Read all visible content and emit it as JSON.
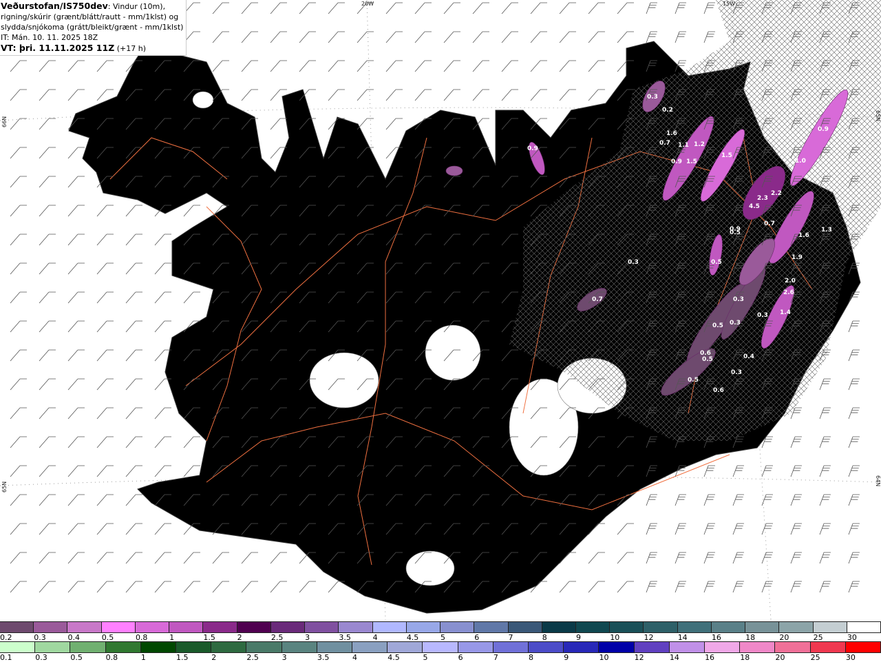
{
  "header": {
    "source": "Veðurstofan/IS750dev",
    "line1": ": Vindur (10m),",
    "line2": "rigning/skúrir (grænt/blátt/rautt - mm/1klst) og",
    "line3": "slydda/snjókoma (grátt/bleikt/grænt - mm/1klst)",
    "it": "IT: Mán. 10. 11. 2025 18Z",
    "vt_bold": "VT: þri. 11.11.2025 11Z",
    "vt_offset": " (+17 h)"
  },
  "grid_labels": {
    "lon_20w": "20W",
    "lon_15w": "15W",
    "lat_left_top": "66N",
    "lat_left_bottom": "65N",
    "lat_right_top": "65N",
    "lat_right_bottom": "64N"
  },
  "map_colors": {
    "land": "#f2e4d6",
    "sea": "#ffffff",
    "glacier": "#ffffff",
    "roads": "#f07040",
    "hatch": "#555555",
    "wind_barbs": "#555555"
  },
  "precip_labels": [
    "0.3",
    "0.2",
    "1.6",
    "0.7",
    "1.1",
    "1.2",
    "0.9",
    "1.5",
    "1.5",
    "1.0",
    "0.9",
    "0.9",
    "2.3",
    "4.5",
    "2.2",
    "0.5",
    "0.7",
    "1.6",
    "1.3",
    "0.5",
    "1.9",
    "2.0",
    "2.6",
    "1.4",
    "0.3",
    "0.5",
    "0.3",
    "0.3",
    "0.6",
    "0.5",
    "0.4",
    "0.3",
    "0.6",
    "0.5",
    "0.3",
    "0.9",
    "0.7"
  ],
  "legend": {
    "snow": {
      "labels": [
        "0.2",
        "0.3",
        "0.4",
        "0.5",
        "0.8",
        "1",
        "1.5",
        "2",
        "2.5",
        "3",
        "3.5",
        "4",
        "4.5",
        "5",
        "6",
        "7",
        "8",
        "9",
        "10",
        "12",
        "14",
        "16",
        "18",
        "20",
        "25",
        "30"
      ],
      "colors": [
        "#6e4a6e",
        "#9a5a9a",
        "#c878c8",
        "#ff80ff",
        "#d86ad8",
        "#c058c0",
        "#8a2a8a",
        "#500050",
        "#6a2a7a",
        "#8050a0",
        "#9a88d0",
        "#b0b8ff",
        "#98a8e8",
        "#8890d0",
        "#6078a8",
        "#3a5878",
        "#0a3a48",
        "#104850",
        "#1a5058",
        "#2e6068",
        "#40707a",
        "#5a8088",
        "#789298",
        "#8ca4a8",
        "#c4ced2",
        "#ffffff"
      ]
    },
    "rain": {
      "labels": [
        "0.1",
        "0.3",
        "0.5",
        "0.8",
        "1",
        "1.5",
        "2",
        "2.5",
        "3",
        "3.5",
        "4",
        "4.5",
        "5",
        "6",
        "7",
        "8",
        "9",
        "10",
        "12",
        "14",
        "16",
        "18",
        "20",
        "25",
        "30"
      ],
      "colors": [
        "#ccffcc",
        "#a0d8a0",
        "#70b070",
        "#307830",
        "#004800",
        "#1a5a2a",
        "#2e6a40",
        "#4a7a68",
        "#5a8480",
        "#7090a0",
        "#8aa0c0",
        "#a0a8d8",
        "#b8b8ff",
        "#9898e8",
        "#7070d8",
        "#4c4cc8",
        "#2828b8",
        "#0000a8",
        "#6040c0",
        "#c090e8",
        "#f0a8e8",
        "#f088c8",
        "#f07098",
        "#f03850",
        "#ff0000"
      ]
    }
  }
}
